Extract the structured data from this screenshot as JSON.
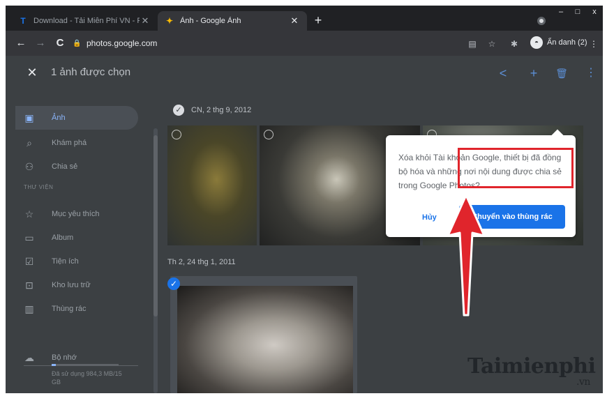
{
  "browser": {
    "tabs": [
      {
        "favicon": "T",
        "title": "Download - Tải Miễn Phí VN - Pi",
        "close": "✕"
      },
      {
        "favicon": "✦",
        "title": "Ảnh - Google Ảnh",
        "close": "✕"
      }
    ],
    "new_tab": "+",
    "window_controls": {
      "minimize": "–",
      "maximize": "□",
      "close": "x"
    },
    "nav": {
      "back": "←",
      "forward": "→",
      "reload": "C"
    },
    "url": "photos.google.com",
    "incognito": {
      "avatar": "◓",
      "label": "Ẩn danh (2)"
    },
    "menu": "⋮"
  },
  "selection_bar": {
    "close": "✕",
    "count_label": "1 ảnh được chọn",
    "actions": {
      "share": "<",
      "add": "+",
      "delete": "🗑",
      "more": "⋮"
    }
  },
  "sidebar": {
    "items": [
      {
        "icon": "▣",
        "label": "Ảnh",
        "active": true
      },
      {
        "icon": "⌕",
        "label": "Khám phá",
        "active": false
      },
      {
        "icon": "⚇",
        "label": "Chia sẻ",
        "active": false
      }
    ],
    "library_heading": "THƯ VIỆN",
    "library_items": [
      {
        "icon": "☆",
        "label": "Mục yêu thích"
      },
      {
        "icon": "▭",
        "label": "Album"
      },
      {
        "icon": "☑",
        "label": "Tiện ích"
      },
      {
        "icon": "⊡",
        "label": "Kho lưu trữ"
      },
      {
        "icon": "▥",
        "label": "Thùng rác"
      }
    ],
    "storage": {
      "icon": "☁",
      "label": "Bộ nhớ",
      "usage_text": "Đã sử dụng 984,3 MB/15 GB",
      "used_fraction": 0.06
    }
  },
  "content": {
    "group1_date": "CN, 2 thg 9, 2012",
    "group2_date": "Th 2, 24 thg 1, 2011"
  },
  "dialog": {
    "message": "Xóa khỏi Tài khoản Google, thiết bị đã đồng bộ hóa và những nơi nội dung được chia sẻ trong Google Photos?",
    "cancel_label": "Hủy",
    "confirm_label": "Chuyển vào thùng rác"
  },
  "watermark": {
    "brand": "Taimienphi",
    "tld": ".vn"
  },
  "colors": {
    "accent": "#1a73e8",
    "highlight": "#e0252c",
    "app_bg": "#3c4043"
  }
}
